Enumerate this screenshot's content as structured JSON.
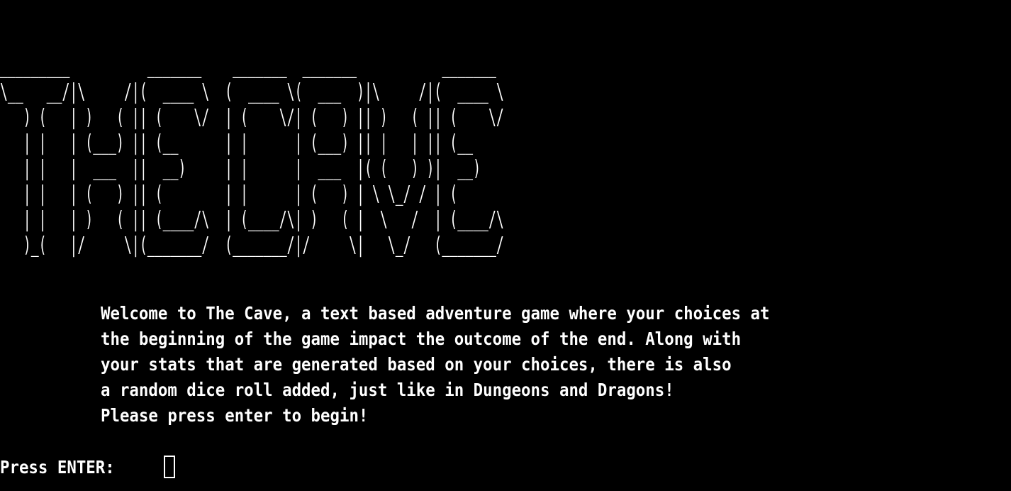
{
  "terminal": {
    "background": "#000000",
    "foreground": "#ffffff",
    "title_art_lines": [
      "_________          _______    _______  _______           _______ ",
      "\\__   __/|\\     /|(  ____ \\  (  ____ \\(  ___  )|\\     /|(  ____ \\",
      "   ) (   | )   ( || (    \\/  | (    \\/| (   ) || )   ( || (    \\/",
      "   | |   | (___) || (__      | |      | (___) || |   | || (__    ",
      "   | |   |  ___  ||  __)     | |      |  ___  |( (   ) )|  __)   ",
      "   | |   | (   ) || (        | |      | (   ) | \\ \\_/ / | (      ",
      "   | |   | )   ( || (____/\\  | (____/\\| )   ( |  \\   /  | (____/\\",
      "   )_(   |/     \\|(_______/  (_______/|/     \\|   \\_/   (_______/"
    ],
    "intro_lines": [
      "Welcome to The Cave, a text based adventure game where your choices at",
      "the beginning of the game impact the outcome of the end. Along with",
      "your stats that are generated based on your choices, there is also",
      "a random dice roll added, just like in Dungeons and Dragons!",
      "Please press enter to begin!"
    ],
    "prompt_label": "Press ENTER: ",
    "cursor_icon": "block-cursor"
  }
}
